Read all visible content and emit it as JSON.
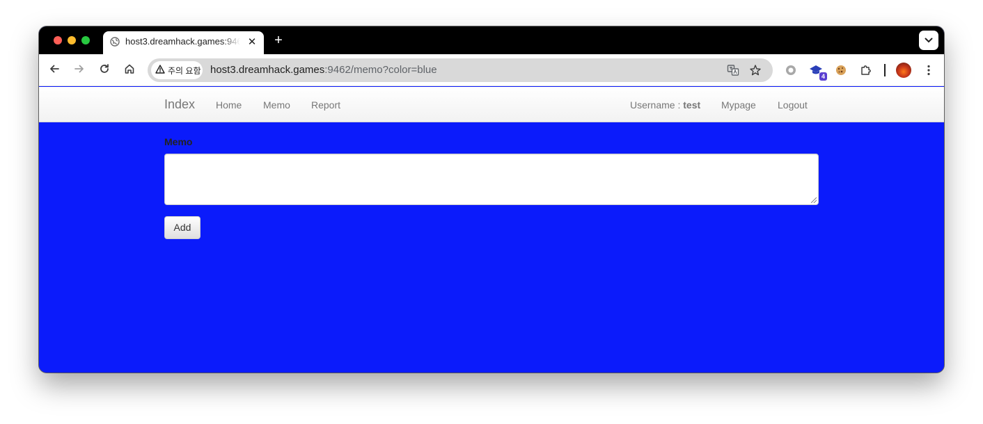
{
  "browser": {
    "tab": {
      "title": "host3.dreamhack.games:9462/memo?color=blue",
      "close_glyph": "✕"
    },
    "new_tab_glyph": "+",
    "address": {
      "security_label": "주의 요함",
      "url_host": "host3.dreamhack.games",
      "url_rest": ":9462/memo?color=blue"
    },
    "extensions": {
      "badge_count": "4"
    },
    "colors": {
      "tabstrip": "#000000",
      "omnibox": "#d9d9d9",
      "page_background": "#0b1bfb"
    }
  },
  "navbar": {
    "brand": "Index",
    "links": [
      "Home",
      "Memo",
      "Report"
    ],
    "user_prefix": "Username : ",
    "username": "test",
    "right_links": [
      "Mypage",
      "Logout"
    ]
  },
  "form": {
    "label": "Memo",
    "textarea_value": "",
    "submit_label": "Add"
  }
}
